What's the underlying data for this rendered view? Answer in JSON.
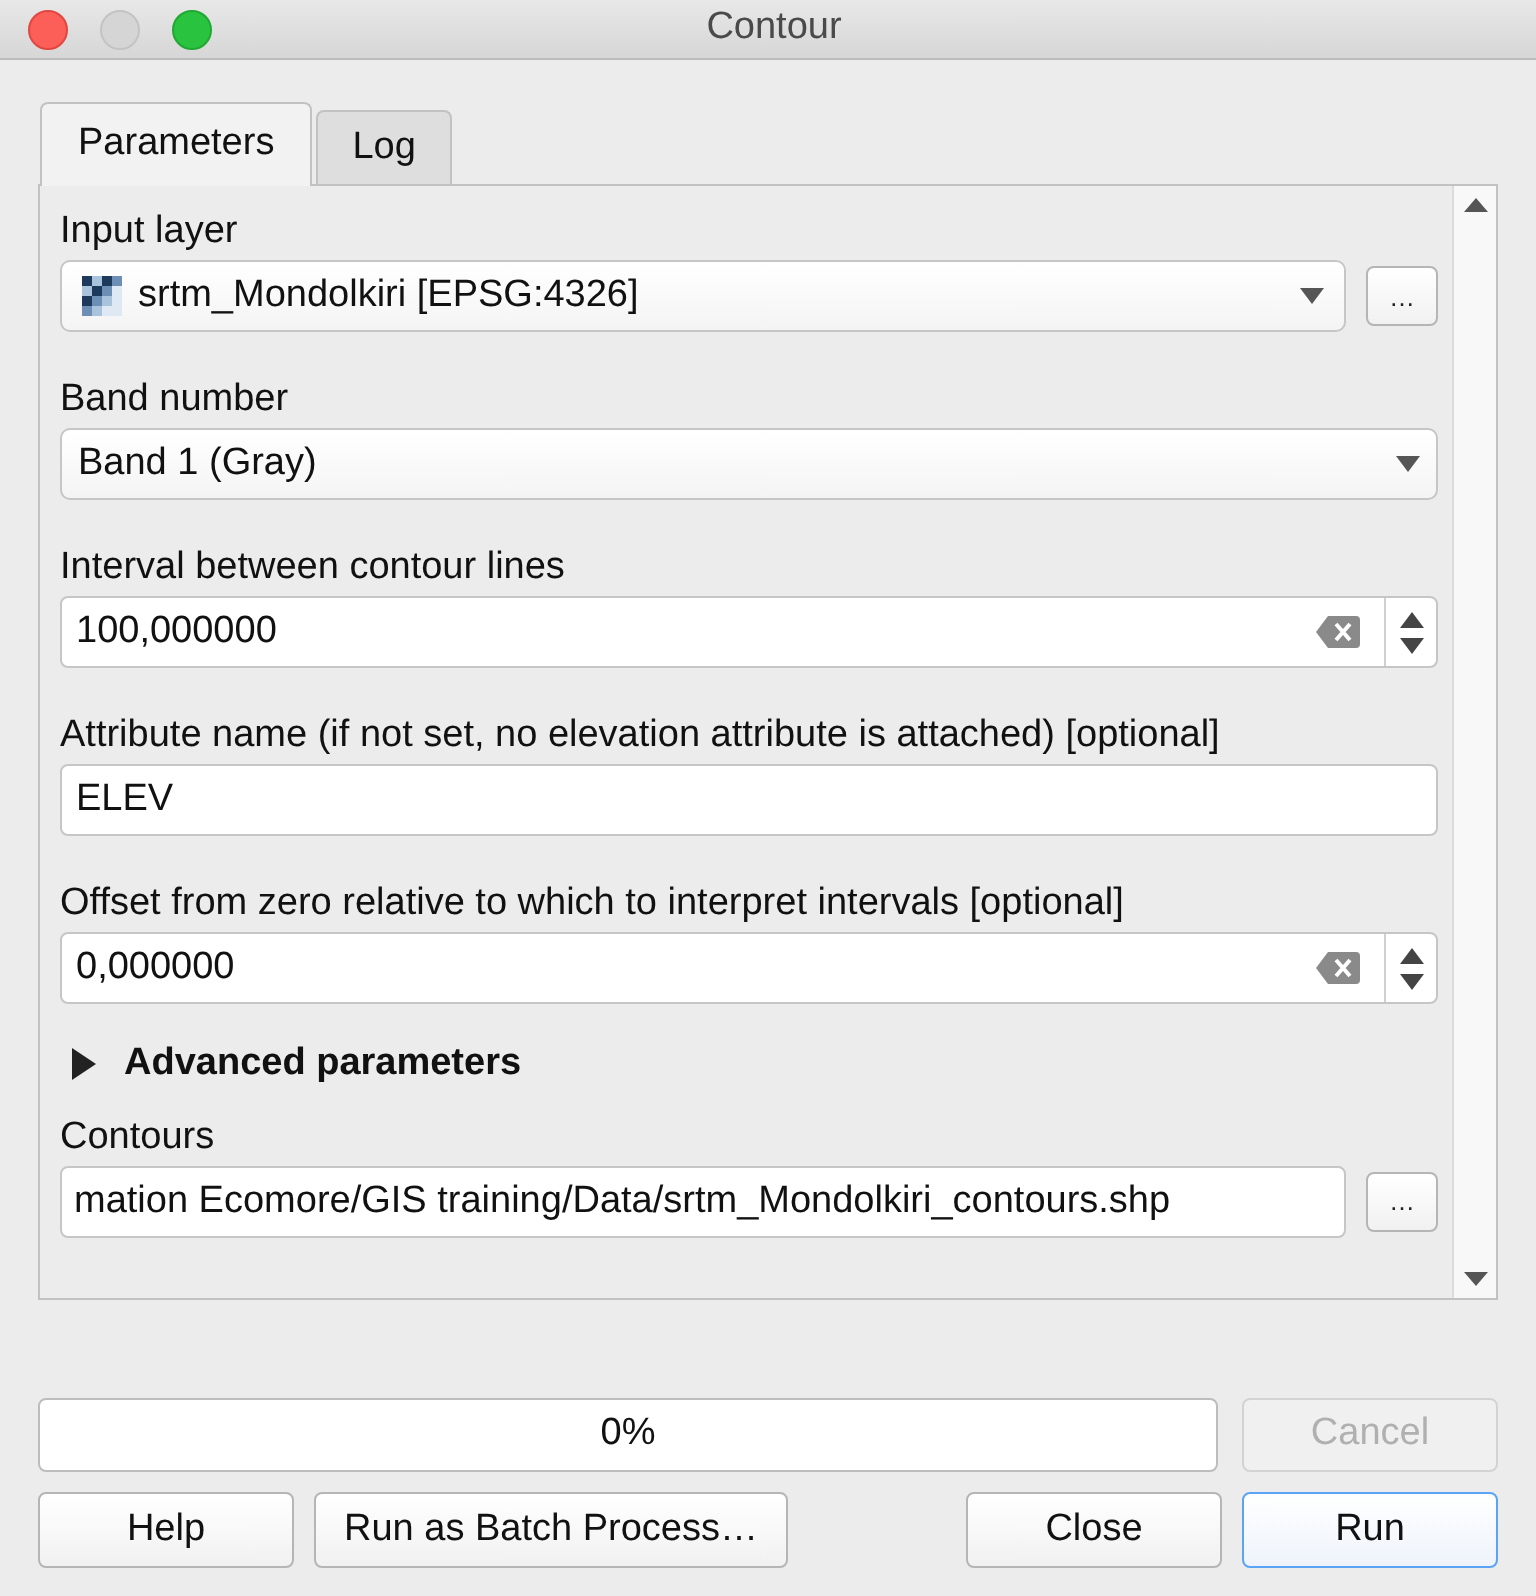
{
  "window": {
    "title": "Contour"
  },
  "tabs": [
    {
      "label": "Parameters",
      "selected": true
    },
    {
      "label": "Log",
      "selected": false
    }
  ],
  "parameters": [
    {
      "kind": "layer_select",
      "label": "Input layer",
      "value": "srtm_Mondolkiri [EPSG:4326]",
      "browse": "…"
    },
    {
      "kind": "select",
      "label": "Band number",
      "value": "Band 1 (Gray)"
    },
    {
      "kind": "spin",
      "label": "Interval between contour lines",
      "value": "100,000000"
    },
    {
      "kind": "text",
      "label": "Attribute name (if not set, no elevation attribute is attached) [optional]",
      "value": "ELEV"
    },
    {
      "kind": "spin",
      "label": "Offset from zero relative to which to interpret intervals [optional]",
      "value": "0,000000"
    },
    {
      "kind": "group",
      "label": "Advanced parameters",
      "expanded": false
    },
    {
      "kind": "file",
      "label": "Contours",
      "value": "mation Ecomore/GIS training/Data/srtm_Mondolkiri_contours.shp",
      "browse": "…"
    }
  ],
  "progress": {
    "level": 0,
    "text": "0%"
  },
  "cancel_button": {
    "label": "Cancel",
    "disabled": true
  },
  "buttons": [
    {
      "label": "Help",
      "default": false
    },
    {
      "label": "Run as Batch Process…",
      "default": false
    },
    {
      "label": "Close",
      "default": false
    },
    {
      "label": "Run",
      "default": true
    }
  ]
}
